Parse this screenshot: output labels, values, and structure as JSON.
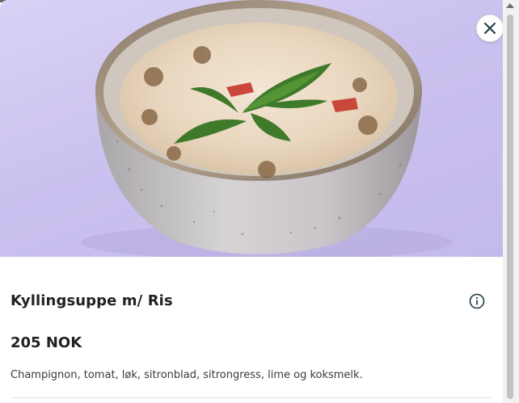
{
  "item": {
    "title": "Kyllingsuppe m/ Ris",
    "price": "205 NOK",
    "description": "Champignon, tomat, løk, sitronblad, sitrongress, lime og koksmelk."
  },
  "icons": {
    "close": "close-icon",
    "info": "info-icon"
  },
  "colors": {
    "background_lavender": "#c9bff0",
    "text_dark": "#202125",
    "icon_teal": "#1f3b45"
  }
}
